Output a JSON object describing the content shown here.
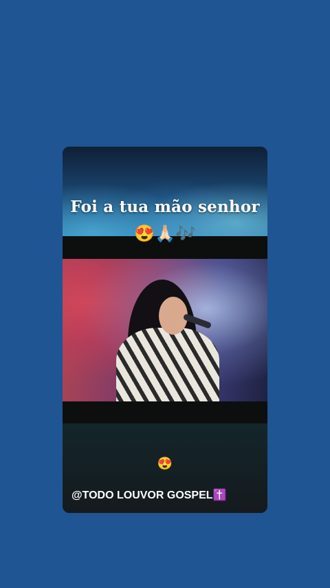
{
  "story": {
    "caption_line1": "Foi a tua mão senhor",
    "caption_emojis": "😍🙏🏻🎶",
    "middle_emoji": "😍",
    "credit": "@TODO LOUVOR GOSPEL✝️"
  },
  "colors": {
    "background": "#1f5592",
    "card": "#14191f",
    "text": "#ffffff"
  }
}
